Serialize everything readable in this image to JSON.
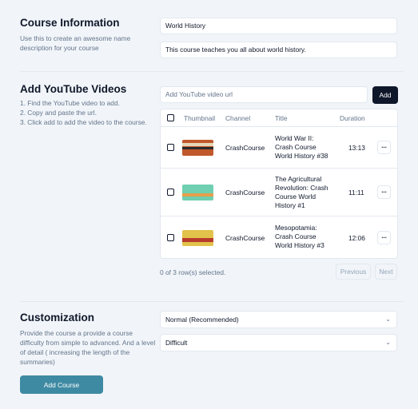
{
  "course_info": {
    "heading": "Course Information",
    "description": "Use this to create an awesome name description for your course",
    "name_value": "World History",
    "description_value": "This course teaches you all about world history."
  },
  "videos": {
    "heading": "Add YouTube Videos",
    "steps": [
      "1. Find the YouTube video to add.",
      "2. Copy and paste the url.",
      "3. Click add to add the video to the course."
    ],
    "url_placeholder": "Add YouTube video url",
    "add_label": "Add",
    "table": {
      "headers": [
        "Thumbnail",
        "Channel",
        "Title",
        "Duration"
      ],
      "rows": [
        {
          "thumb_color": "#c0582b",
          "thumb_accent": "#e6d7b8",
          "channel": "CrashCourse",
          "title": "World War II: Crash Course World History #38",
          "duration": "13:13",
          "more": "···"
        },
        {
          "thumb_color": "#6fcfb0",
          "thumb_accent": "#e69e4a",
          "channel": "CrashCourse",
          "title": "The Agricultural Revolution: Crash Course World History #1",
          "duration": "11:11",
          "more": "···"
        },
        {
          "thumb_color": "#e2c24a",
          "thumb_accent": "#b83b2b",
          "channel": "CrashCourse",
          "title": "Mesopotamia: Crash Course World History #3",
          "duration": "12:06",
          "more": "···"
        }
      ]
    },
    "selection_status": "0 of 3 row(s) selected.",
    "previous_label": "Previous",
    "next_label": "Next"
  },
  "customization": {
    "heading": "Customization",
    "description": "Provide the course a provide a course difficulty from simple to advanced. And a level of detail ( increasing the length of the summaries)",
    "difficulty_value": "Normal (Recommended)",
    "detail_value": "Difficult"
  },
  "submit_label": "Add Course"
}
